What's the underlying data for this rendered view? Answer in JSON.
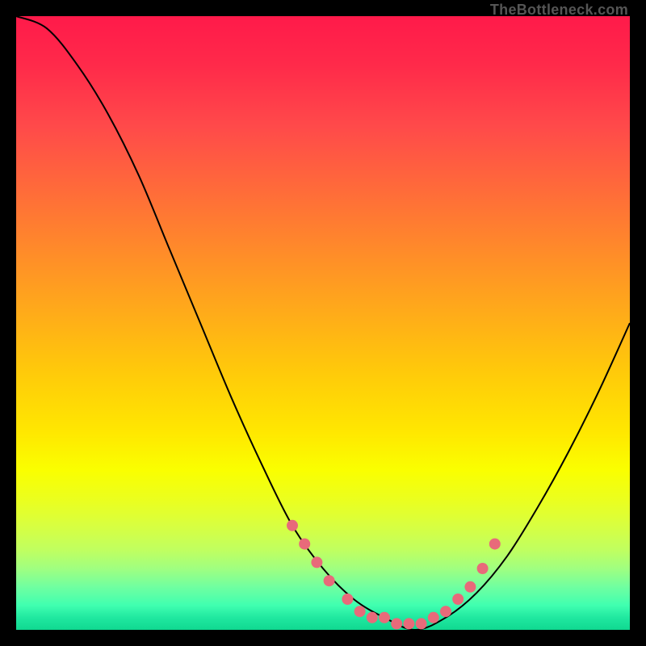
{
  "watermark": "TheBottleneck.com",
  "chart_data": {
    "type": "line",
    "title": "",
    "xlabel": "",
    "ylabel": "",
    "xlim": [
      0,
      100
    ],
    "ylim": [
      0,
      100
    ],
    "curve": {
      "x": [
        0,
        5,
        10,
        15,
        20,
        25,
        30,
        35,
        40,
        45,
        50,
        55,
        60,
        65,
        70,
        75,
        80,
        85,
        90,
        95,
        100
      ],
      "y": [
        100,
        98,
        92,
        84,
        74,
        62,
        50,
        38,
        27,
        17,
        10,
        5,
        2,
        0,
        2,
        6,
        12,
        20,
        29,
        39,
        50
      ]
    },
    "markers": {
      "x": [
        45,
        47,
        49,
        51,
        54,
        56,
        58,
        60,
        62,
        64,
        66,
        68,
        70,
        72,
        74,
        76,
        78
      ],
      "y": [
        17,
        14,
        11,
        8,
        5,
        3,
        2,
        2,
        1,
        1,
        1,
        2,
        3,
        5,
        7,
        10,
        14
      ]
    },
    "marker_color": "#e86a7a",
    "curve_color": "#000000"
  }
}
